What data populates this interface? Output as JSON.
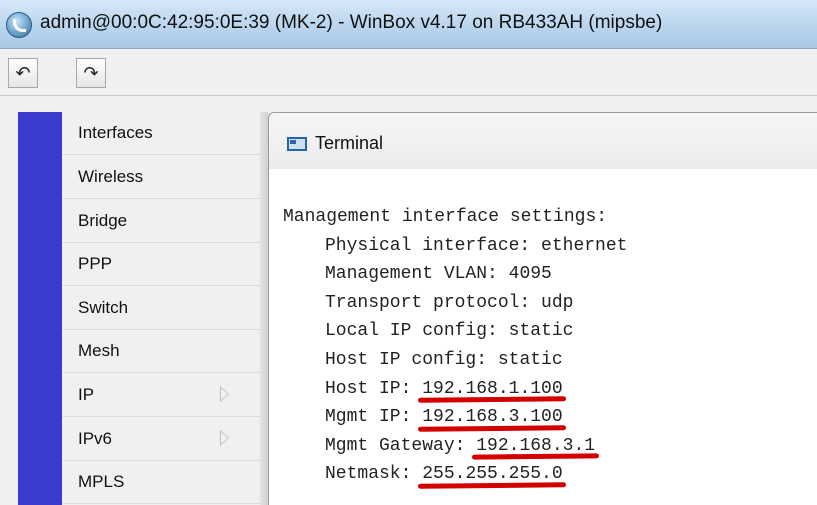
{
  "window": {
    "title": "admin@00:0C:42:95:0E:39 (MK-2) - WinBox v4.17 on RB433AH (mipsbe)"
  },
  "toolbar": {
    "undo_icon": "↶",
    "redo_icon": "↷"
  },
  "sidebar": {
    "items": [
      {
        "label": "Interfaces"
      },
      {
        "label": "Wireless"
      },
      {
        "label": "Bridge"
      },
      {
        "label": "PPP"
      },
      {
        "label": "Switch"
      },
      {
        "label": "Mesh"
      },
      {
        "label": "IP",
        "has_submenu": true
      },
      {
        "label": "IPv6",
        "has_submenu": true
      },
      {
        "label": "MPLS"
      }
    ]
  },
  "terminal": {
    "title": "Terminal",
    "heading": "Management interface settings:",
    "lines": [
      {
        "label": "Physical interface:",
        "value": "ethernet"
      },
      {
        "label": "Management VLAN:",
        "value": "4095"
      },
      {
        "label": "Transport protocol:",
        "value": "udp"
      },
      {
        "label": "Local IP config:",
        "value": "static"
      },
      {
        "label": "Host IP config:",
        "value": "static"
      },
      {
        "label": "Host IP:",
        "value": "192.168.1.100"
      },
      {
        "label": "Mgmt IP:",
        "value": "192.168.3.100"
      },
      {
        "label": "Mgmt Gateway:",
        "value": "192.168.3.1"
      },
      {
        "label": "Netmask:",
        "value": "255.255.255.0"
      }
    ]
  },
  "colors": {
    "sidebar_strip": "#3b3bd0",
    "highlight_underline": "#d40000"
  }
}
